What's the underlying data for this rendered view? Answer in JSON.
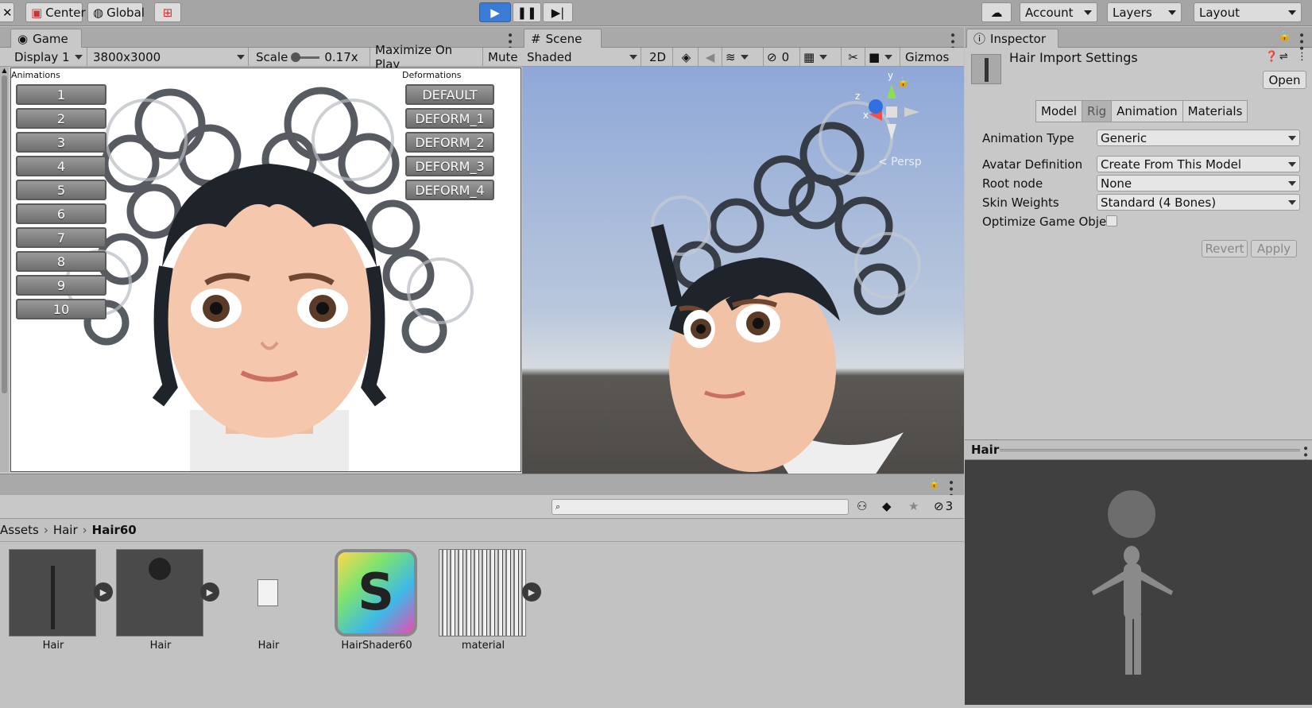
{
  "toolbar": {
    "center": "Center",
    "global": "Global",
    "account": "Account",
    "layers": "Layers",
    "layout": "Layout"
  },
  "game": {
    "tab": "Game",
    "display": "Display 1",
    "resolution": "3800x3000",
    "scale_label": "Scale",
    "scale_value": "0.17x",
    "maximize": "Maximize On Play",
    "mute": "Mute",
    "animations_label": "Animations",
    "deformations_label": "Deformations",
    "anim_buttons": [
      "1",
      "2",
      "3",
      "4",
      "5",
      "6",
      "7",
      "8",
      "9",
      "10"
    ],
    "deform_buttons": [
      "DEFAULT",
      "DEFORM_1",
      "DEFORM_2",
      "DEFORM_3",
      "DEFORM_4"
    ]
  },
  "scene": {
    "tab": "Scene",
    "shading": "Shaded",
    "mode_2d": "2D",
    "hidden_count": "0",
    "gizmos": "Gizmos",
    "persp": "< Persp",
    "axis_y": "y",
    "axis_z": "z",
    "axis_x": "x"
  },
  "inspector": {
    "tab": "Inspector",
    "title": "Hair Import Settings",
    "open": "Open",
    "tabs": [
      "Model",
      "Rig",
      "Animation",
      "Materials"
    ],
    "rows": [
      {
        "label": "Animation Type",
        "value": "Generic"
      },
      {
        "label": "Avatar Definition",
        "value": "Create From This Model"
      },
      {
        "label": "Root node",
        "value": "None"
      },
      {
        "label": "Skin Weights",
        "value": "Standard (4 Bones)"
      }
    ],
    "optimize_label": "Optimize Game Obje",
    "revert": "Revert",
    "apply": "Apply",
    "preview_title": "Hair"
  },
  "project": {
    "hidden_count": "3",
    "breadcrumb": [
      "Assets",
      "Hair",
      "Hair60"
    ],
    "assets": [
      {
        "name": "Hair"
      },
      {
        "name": "Hair"
      },
      {
        "name": "Hair"
      },
      {
        "name": "HairShader60"
      },
      {
        "name": "material"
      }
    ]
  },
  "colors": {
    "play_blue": "#3a7bd5",
    "sky_top": "#8fa8d8",
    "ground": "#4d4a47"
  }
}
